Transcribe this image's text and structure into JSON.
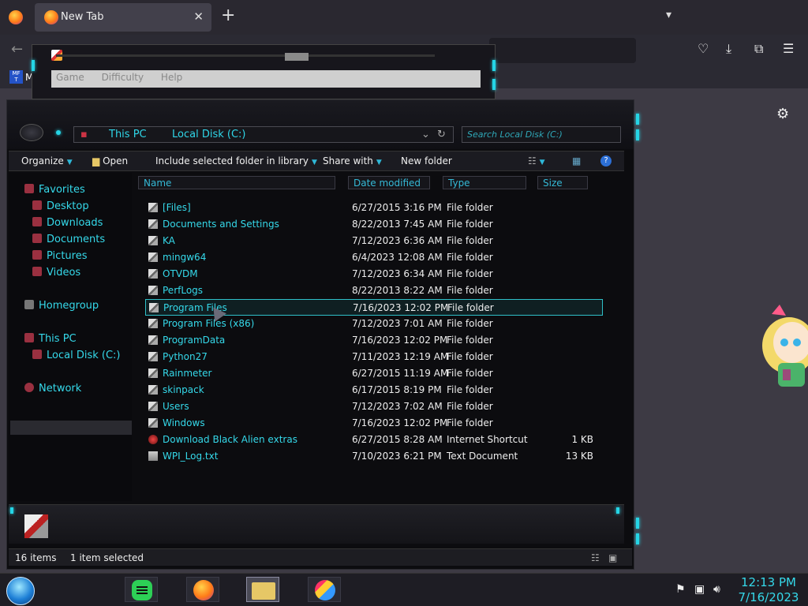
{
  "browser": {
    "tab_title": "New Tab",
    "bookmark_label": "M"
  },
  "bg_window": {
    "menu": [
      "Game",
      "Difficulty",
      "Help"
    ]
  },
  "explorer": {
    "address": [
      "This PC",
      "Local Disk (C:)"
    ],
    "search_placeholder": "Search Local Disk (C:)",
    "toolbar": {
      "organize": "Organize",
      "open": "Open",
      "include": "Include selected folder in library",
      "share": "Share with",
      "new_folder": "New folder"
    },
    "sidebar": {
      "favorites": "Favorites",
      "desktop": "Desktop",
      "downloads": "Downloads",
      "documents": "Documents",
      "pictures": "Pictures",
      "videos": "Videos",
      "homegroup": "Homegroup",
      "this_pc": "This PC",
      "local_disk": "Local Disk (C:)",
      "network": "Network"
    },
    "columns": {
      "name": "Name",
      "date": "Date modified",
      "type": "Type",
      "size": "Size"
    },
    "files": [
      {
        "name": "[Files]",
        "date": "6/27/2015 3:16 PM",
        "type": "File folder",
        "size": ""
      },
      {
        "name": "Documents and Settings",
        "date": "8/22/2013 7:45 AM",
        "type": "File folder",
        "size": ""
      },
      {
        "name": "KA",
        "date": "7/12/2023 6:36 AM",
        "type": "File folder",
        "size": ""
      },
      {
        "name": "mingw64",
        "date": "6/4/2023 12:08 AM",
        "type": "File folder",
        "size": ""
      },
      {
        "name": "OTVDM",
        "date": "7/12/2023 6:34 AM",
        "type": "File folder",
        "size": ""
      },
      {
        "name": "PerfLogs",
        "date": "8/22/2013 8:22 AM",
        "type": "File folder",
        "size": ""
      },
      {
        "name": "Program Files",
        "date": "7/16/2023 12:02 PM",
        "type": "File folder",
        "size": ""
      },
      {
        "name": "Program Files (x86)",
        "date": "7/12/2023 7:01 AM",
        "type": "File folder",
        "size": ""
      },
      {
        "name": "ProgramData",
        "date": "7/16/2023 12:02 PM",
        "type": "File folder",
        "size": ""
      },
      {
        "name": "Python27",
        "date": "7/11/2023 12:19 AM",
        "type": "File folder",
        "size": ""
      },
      {
        "name": "Rainmeter",
        "date": "6/27/2015 11:19 AM",
        "type": "File folder",
        "size": ""
      },
      {
        "name": "skinpack",
        "date": "6/17/2015 8:19 PM",
        "type": "File folder",
        "size": ""
      },
      {
        "name": "Users",
        "date": "7/12/2023 7:02 AM",
        "type": "File folder",
        "size": ""
      },
      {
        "name": "Windows",
        "date": "7/16/2023 12:02 PM",
        "type": "File folder",
        "size": ""
      },
      {
        "name": "Download Black Alien extras",
        "date": "6/27/2015 8:28 AM",
        "type": "Internet Shortcut",
        "size": "1 KB"
      },
      {
        "name": "WPI_Log.txt",
        "date": "7/10/2023 6:21 PM",
        "type": "Text Document",
        "size": "13 KB"
      }
    ],
    "status": {
      "count": "16 items",
      "selected": "1 item selected"
    }
  },
  "taskbar": {
    "time": "12:13 PM",
    "date": "7/16/2023"
  },
  "colors": {
    "accent_cyan": "#35d9ea",
    "explorer_bg": "#0c0c0f"
  }
}
